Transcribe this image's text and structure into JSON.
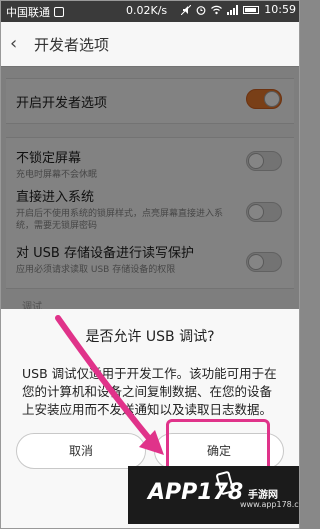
{
  "status_bar": {
    "carrier": "中国联通",
    "speed": "0.02K/s",
    "time": "10:59"
  },
  "header": {
    "title": "开发者选项"
  },
  "settings": {
    "dev_options": {
      "label": "开启开发者选项",
      "enabled": true
    },
    "stay_awake": {
      "label": "不锁定屏幕",
      "sub": "充电时屏幕不会休眠",
      "enabled": false
    },
    "direct_system": {
      "label": "直接进入系统",
      "sub": "开启后不使用系统的锁屏样式，点亮屏幕直接进入系统，需要无锁屏密码",
      "enabled": false
    },
    "usb_protect": {
      "label": "对 USB 存储设备进行读写保护",
      "sub": "应用必须请求读取 USB 存储设备的权限",
      "enabled": false
    },
    "debug_section": "调试"
  },
  "dialog": {
    "title": "是否允许 USB 调试?",
    "body": "USB 调试仅适用于开发工作。该功能可用于在您的计算机和设备之间复制数据、在您的设备上安装应用而不发送通知以及读取日志数据。",
    "cancel_label": "取消",
    "ok_label": "确定"
  },
  "watermark": {
    "main": "APP178",
    "sub": "手游网",
    "domain": "www.app178.com"
  },
  "colors": {
    "toggle_on": "#e87a2c",
    "annotation": "#e0338a"
  }
}
